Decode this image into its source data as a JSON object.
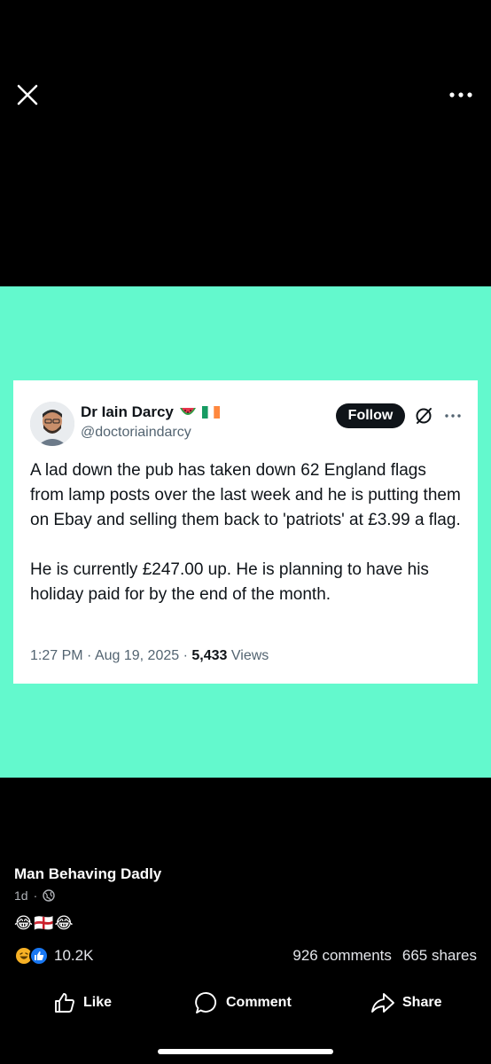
{
  "topbar": {
    "close_icon": "close-icon",
    "more_icon": "more-horizontal-icon"
  },
  "tweet": {
    "display_name": "Dr Iain Darcy",
    "name_emoji": [
      "watermelon",
      "irish-flag"
    ],
    "handle": "@doctoriaindarcy",
    "follow_label": "Follow",
    "body_paragraphs": [
      "A lad down the pub has taken down 62 England flags from lamp posts over the last week and he is putting them on Ebay and selling them back to 'patriots' at £3.99 a flag.",
      "He is currently £247.00 up. He is planning to have his holiday paid for by the end of the month."
    ],
    "time": "1:27 PM",
    "date": "Aug 19, 2025",
    "views_count": "5,433",
    "views_label": "Views",
    "sep": "·"
  },
  "post": {
    "page_name": "Man Behaving Dadly",
    "age": "1d",
    "sep": "·",
    "caption": "😂🏴󠁧󠁢󠁥󠁮󠁧󠁿😂"
  },
  "stats": {
    "reaction_count": "10.2K",
    "comments": "926 comments",
    "shares": "665 shares"
  },
  "actions": {
    "like": "Like",
    "comment": "Comment",
    "share": "Share"
  },
  "colors": {
    "media_bg": "#63f9cd",
    "like_blue": "#1877f2",
    "haha_yellow": "#f7b125",
    "follow_bg": "#0f1419"
  }
}
